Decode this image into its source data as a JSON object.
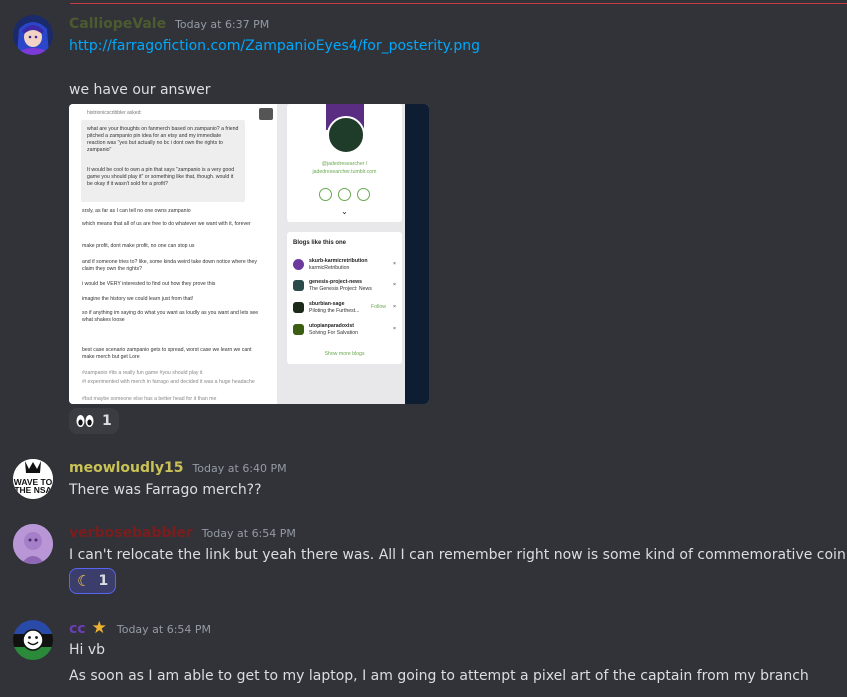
{
  "messages": [
    {
      "username": "CalliopeVale",
      "username_color": "#4c5b2f",
      "timestamp": "Today at 6:37 PM",
      "link": "http://farragofiction.com/ZampanioEyes4/for_posterity.png",
      "text": "we have our answer",
      "avatar_icon": "anime-character-avatar",
      "embed": {
        "asker_line": "histrionicscribbler asked:",
        "question": "what are your thoughts on fanmerch based on zampanio? a friend pitched a zampanio pin idea for an etsy and my immediate reaction was \"yes but actually no bc i dont own the rights to zampanio\"",
        "question2": "It would be cool to own a pin that says \"zampanio is a very good game you should play it\" or something like that, though. would it be okay if it wasn't sold for a profit?",
        "answer": [
          "srsly, as far as I can tell no one owns zampanio",
          "which means that all of us are free to do whatever we want with it, forever",
          "make profit, dont make profit, no one can stop us",
          "and if someone tries to? like, some kinda weird take down notice where they claim they own the rights?",
          "i would be VERY interested to find out how they prove this",
          "imagine the history we could learn just from that!",
          "so if anything im saying do what you want as loudly as you want and lets see what shakes loose",
          "best case scenario zampanio gets to spread, worst case we learn we cant make merch but get Lore"
        ],
        "tags": [
          "#zampanio  #its a really fun game  #you should play it",
          "#i experimented with merch in farrago and decided it was a huge headache",
          "#but maybe someone else has a better head for it than me"
        ],
        "profile_handle": "@jadedresearcher /",
        "profile_url": "jadedresearcher.tumblr.com",
        "blogs_header": "Blogs like this one",
        "blogs": [
          {
            "name": "skurb-karmicretribution",
            "desc": "karmicRetribution",
            "action": "×"
          },
          {
            "name": "genesis-project-news",
            "desc": "The Genesis Project: News",
            "action": "×"
          },
          {
            "name": "sburbian-sage",
            "desc": "Piloting the Furthest...",
            "action": "×",
            "follow": "Follow"
          },
          {
            "name": "utopianparadoxist",
            "desc": "Solving For Salvation",
            "action": "×"
          }
        ],
        "show_more": "Show more blogs"
      },
      "reaction": {
        "emoji": "eyes-emoji",
        "count": "1"
      }
    },
    {
      "username": "meowloudly15",
      "username_color": "#c9c255",
      "timestamp": "Today at 6:40 PM",
      "text": "There was Farrago merch??",
      "avatar_icon": "wave-to-the-nsa-avatar",
      "avatar_text": [
        "WAVE TO",
        "THE NSA"
      ]
    },
    {
      "username": "verbosebabbler",
      "username_color": "#7b1d1d",
      "timestamp": "Today at 6:54 PM",
      "text": "I can't relocate the link but yeah there was. All I can remember right now is some kind of commemorative coin.",
      "avatar_icon": "purple-character-avatar",
      "reaction": {
        "emoji": "crescent-moon-emoji",
        "count": "1"
      }
    },
    {
      "username": "cc",
      "username_color": "#6a3fb5",
      "timestamp": "Today at 6:54 PM",
      "badge_icon": "star-icon",
      "text": "Hi vb",
      "text2": "As soon as I am able to get to my laptop, I am going to attempt a pixel art of the captain from my branch",
      "avatar_icon": "smiley-flag-avatar"
    }
  ]
}
